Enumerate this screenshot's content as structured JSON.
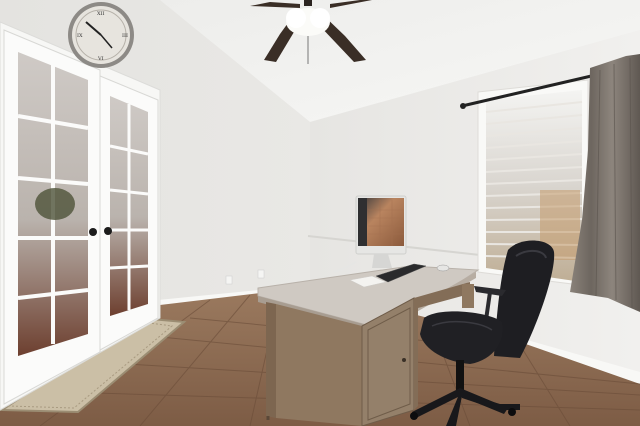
{
  "scene": {
    "type": "home office room photo",
    "colors": {
      "wall": "#ecebe8",
      "wall_shadow": "#d9d8d4",
      "ceiling": "#f3f3f1",
      "floor_tile": "#8e6a50",
      "floor_grout": "#6e503c",
      "door_frame": "#f7f7f5",
      "desk_top": "#cfc9c2",
      "desk_wood": "#8f7860",
      "curtain": "#7a726a",
      "chair": "#1e1e22",
      "fan_blade": "#3a2e26"
    },
    "objects": [
      "ceiling-fan",
      "wall-clock",
      "french-doors",
      "door-mat",
      "desk",
      "monitor",
      "keyboard",
      "mouse",
      "office-chair",
      "window-blinds",
      "curtain"
    ]
  }
}
